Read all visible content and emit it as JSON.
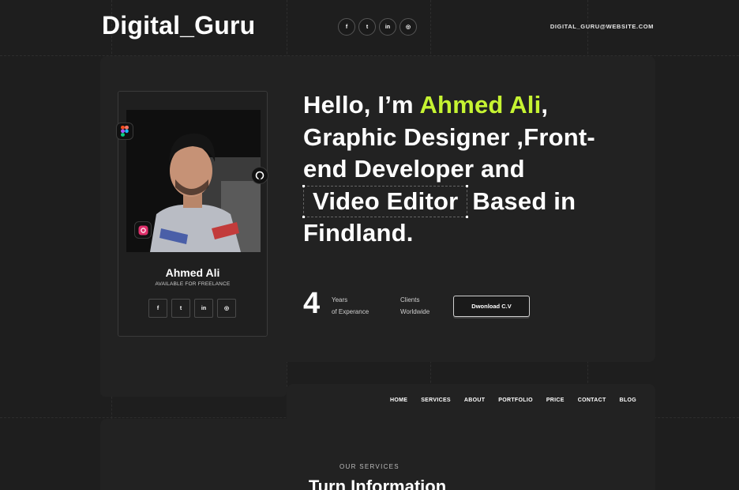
{
  "brand": {
    "logo": "Digital_Guru",
    "email": "DIGITAL_GURU@WEBSITE.COM",
    "accent_color": "#c6f432"
  },
  "header_social": [
    {
      "icon": "facebook-icon",
      "glyph": "f"
    },
    {
      "icon": "twitter-icon",
      "glyph": "t"
    },
    {
      "icon": "linkedin-icon",
      "glyph": "in"
    },
    {
      "icon": "instagram-icon",
      "glyph": "◎"
    }
  ],
  "profile": {
    "name": "Ahmed Ali",
    "status": "AVAILABLE FOR FREELANCE",
    "badges": [
      "figma-icon",
      "github-icon",
      "instagram-icon"
    ],
    "social": [
      {
        "icon": "facebook-icon",
        "glyph": "f"
      },
      {
        "icon": "twitter-icon",
        "glyph": "t"
      },
      {
        "icon": "linkedin-icon",
        "glyph": "in"
      },
      {
        "icon": "instagram-icon",
        "glyph": "◎"
      }
    ]
  },
  "hero": {
    "intro": "Hello, I’m ",
    "name": "Ahmed Ali",
    "comma": ",",
    "roles_line": "Graphic Designer ,Front-end Developer and",
    "highlight": "Video Editor",
    "location": "Based in Findland."
  },
  "stats": {
    "years_number": "4",
    "years_line1": "Years",
    "years_line2": "of Experance",
    "clients_line1": "Clients",
    "clients_line2": "Worldwide"
  },
  "cv_button": "Dwonload C.V",
  "nav": [
    "HOME",
    "SERVICES",
    "ABOUT",
    "PORTFOLIO",
    "PRICE",
    "CONTACT",
    "BLOG"
  ],
  "services": {
    "label": "OUR SERVICES",
    "title": "Turn Information"
  }
}
